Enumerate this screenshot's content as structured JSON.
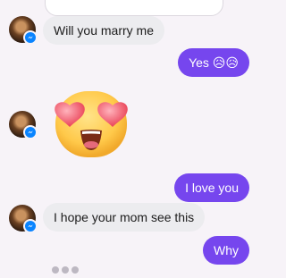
{
  "colors": {
    "background": "#f7f3f8",
    "incoming_bubble": "#ececef",
    "outgoing_bubble": "#7646ee",
    "messenger_badge": "#0a84ff"
  },
  "messages": [
    {
      "direction": "incoming",
      "text": "Will you marry me"
    },
    {
      "direction": "outgoing",
      "text": "Yes 😥😥"
    },
    {
      "direction": "incoming",
      "type": "sticker",
      "icon": "heart-eyes-emoji-icon"
    },
    {
      "direction": "outgoing",
      "text": "I love you"
    },
    {
      "direction": "incoming",
      "text": "I hope your mom see this"
    },
    {
      "direction": "outgoing",
      "text": "Why"
    }
  ]
}
